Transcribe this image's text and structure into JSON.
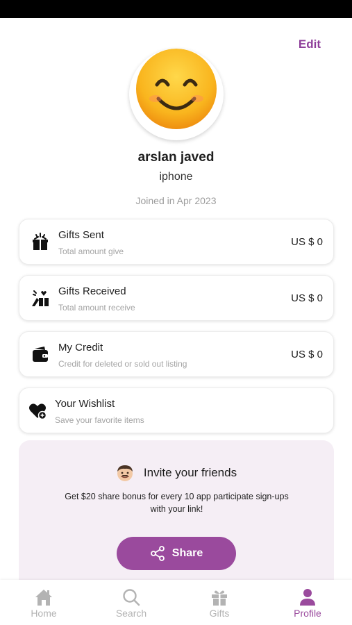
{
  "header": {
    "edit_label": "Edit"
  },
  "profile": {
    "name": "arslan javed",
    "device": "iphone",
    "joined": "Joined in Apr 2023"
  },
  "cards": [
    {
      "title": "Gifts Sent",
      "subtitle": "Total amount give",
      "amount": "US $ 0",
      "icon": "gift-box-open-icon"
    },
    {
      "title": "Gifts Received",
      "subtitle": "Total amount receive",
      "amount": "US $ 0",
      "icon": "gift-hands-icon"
    },
    {
      "title": "My Credit",
      "subtitle": "Credit for deleted or sold out listing",
      "amount": "US $ 0",
      "icon": "wallet-icon"
    },
    {
      "title": "Your Wishlist",
      "subtitle": "Save your favorite items",
      "icon": "heart-add-icon"
    }
  ],
  "invite": {
    "title": "Invite your friends",
    "text": "Get $20 share bonus for every 10 app participate sign-ups with your link!",
    "share_label": "Share"
  },
  "tabs": [
    {
      "label": "Home",
      "icon": "home-icon",
      "active": false
    },
    {
      "label": "Search",
      "icon": "search-icon",
      "active": false
    },
    {
      "label": "Gifts",
      "icon": "gift-icon",
      "active": false
    },
    {
      "label": "Profile",
      "icon": "profile-icon",
      "active": true
    }
  ],
  "colors": {
    "accent": "#9a4a9d",
    "invite_bg": "#f5eef5",
    "inactive": "#b3b3b3"
  }
}
